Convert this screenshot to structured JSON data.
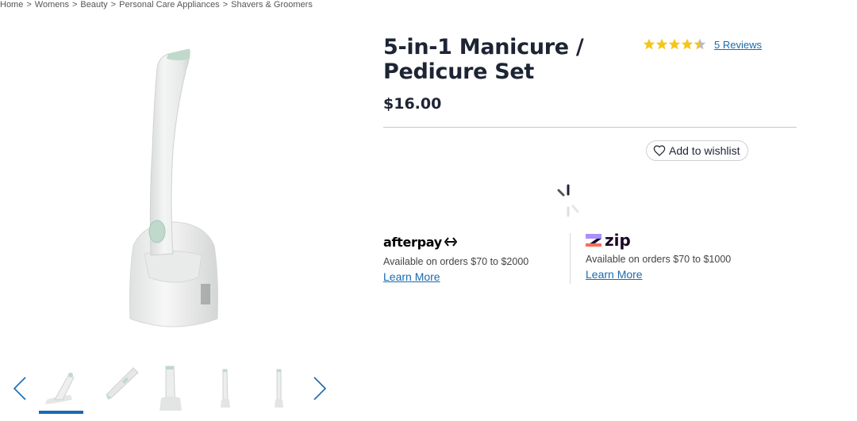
{
  "breadcrumb": {
    "items": [
      "Home",
      "Womens",
      "Beauty",
      "Personal Care Appliances",
      "Shavers & Groomers"
    ],
    "separator": ">"
  },
  "product": {
    "title": "5-in-1 Manicure / Pedicure Set",
    "price": "$16.00",
    "rating": 4.5,
    "reviews_label": "5 Reviews",
    "wishlist_label": "Add to wishlist"
  },
  "payments": {
    "afterpay": {
      "logo_text": "afterpay",
      "text": "Available on orders $70 to $2000",
      "link": "Learn More"
    },
    "zip": {
      "logo_text": "zip",
      "text": "Available on orders $70 to $1000",
      "link": "Learn More"
    }
  },
  "gallery": {
    "thumb_count": 5,
    "active_index": 0
  },
  "colors": {
    "text": "#1d2433",
    "link": "#1a6bb0",
    "star": "#f5c518",
    "device_accent": "#bfd9cb"
  },
  "icons": {
    "wishlist": "heart-icon",
    "prev": "chevron-left-icon",
    "next": "chevron-right-icon",
    "loading": "spinner-icon"
  }
}
